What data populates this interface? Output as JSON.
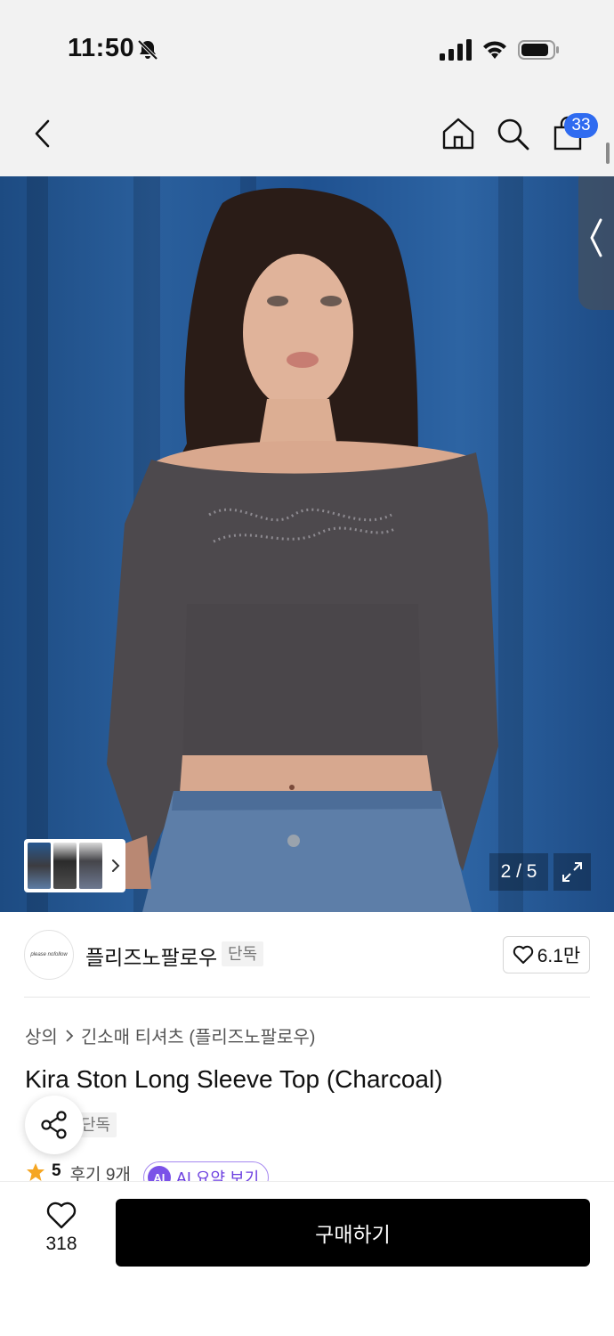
{
  "status_bar": {
    "time": "11:50",
    "icons": [
      "bell-slash-icon",
      "signal-icon",
      "wifi-icon",
      "battery-icon"
    ]
  },
  "nav": {
    "cart_count": "33",
    "icons": [
      "chevron-left-icon",
      "home-icon",
      "search-icon",
      "shopping-bag-icon"
    ]
  },
  "gallery": {
    "page_counter": "2 / 5",
    "current_page": 2,
    "total_pages": 5
  },
  "brand": {
    "name": "플리즈노팔로우",
    "tag": "단독",
    "logo_text": "please nofollow",
    "like_count": "6.1만"
  },
  "breadcrumb": {
    "category": "상의",
    "subcategory": "긴소매 티셔츠 (플리즈노팔로우)"
  },
  "product": {
    "title": "Kira Ston Long Sleeve Top (Charcoal)",
    "tag": "단독",
    "rating": "5",
    "reviews": "후기 9개",
    "ai_badge": "AI",
    "ai_summary": "AI 요약 보기"
  },
  "bottom_bar": {
    "wish_count": "318",
    "buy_label": "구매하기"
  },
  "colors": {
    "accent": "#2f6bf0",
    "buy_button": "#000000",
    "ai_purple": "#7b52e8",
    "star": "#f5a623",
    "backdrop_blue": "#24578f"
  }
}
